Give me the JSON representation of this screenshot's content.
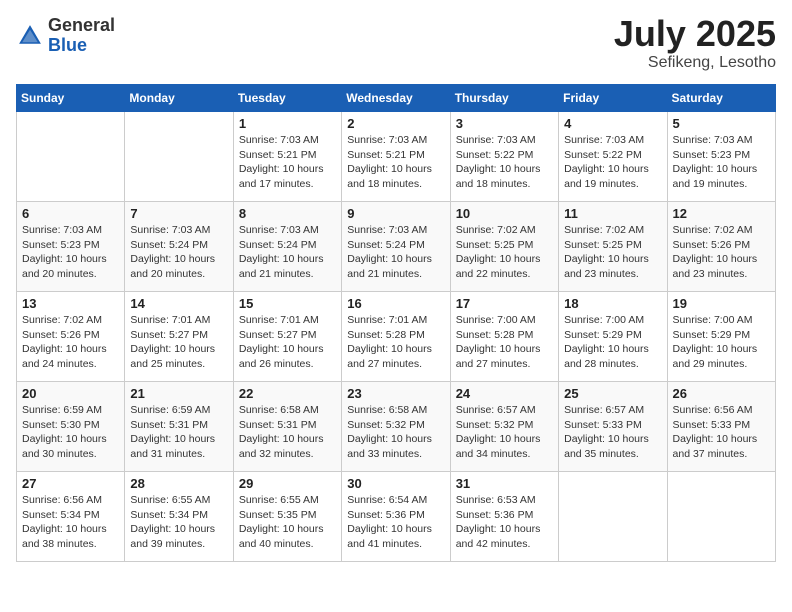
{
  "header": {
    "logo_general": "General",
    "logo_blue": "Blue",
    "month_year": "July 2025",
    "location": "Sefikeng, Lesotho"
  },
  "days_of_week": [
    "Sunday",
    "Monday",
    "Tuesday",
    "Wednesday",
    "Thursday",
    "Friday",
    "Saturday"
  ],
  "weeks": [
    [
      {
        "day": "",
        "info": ""
      },
      {
        "day": "",
        "info": ""
      },
      {
        "day": "1",
        "info": "Sunrise: 7:03 AM\nSunset: 5:21 PM\nDaylight: 10 hours and 17 minutes."
      },
      {
        "day": "2",
        "info": "Sunrise: 7:03 AM\nSunset: 5:21 PM\nDaylight: 10 hours and 18 minutes."
      },
      {
        "day": "3",
        "info": "Sunrise: 7:03 AM\nSunset: 5:22 PM\nDaylight: 10 hours and 18 minutes."
      },
      {
        "day": "4",
        "info": "Sunrise: 7:03 AM\nSunset: 5:22 PM\nDaylight: 10 hours and 19 minutes."
      },
      {
        "day": "5",
        "info": "Sunrise: 7:03 AM\nSunset: 5:23 PM\nDaylight: 10 hours and 19 minutes."
      }
    ],
    [
      {
        "day": "6",
        "info": "Sunrise: 7:03 AM\nSunset: 5:23 PM\nDaylight: 10 hours and 20 minutes."
      },
      {
        "day": "7",
        "info": "Sunrise: 7:03 AM\nSunset: 5:24 PM\nDaylight: 10 hours and 20 minutes."
      },
      {
        "day": "8",
        "info": "Sunrise: 7:03 AM\nSunset: 5:24 PM\nDaylight: 10 hours and 21 minutes."
      },
      {
        "day": "9",
        "info": "Sunrise: 7:03 AM\nSunset: 5:24 PM\nDaylight: 10 hours and 21 minutes."
      },
      {
        "day": "10",
        "info": "Sunrise: 7:02 AM\nSunset: 5:25 PM\nDaylight: 10 hours and 22 minutes."
      },
      {
        "day": "11",
        "info": "Sunrise: 7:02 AM\nSunset: 5:25 PM\nDaylight: 10 hours and 23 minutes."
      },
      {
        "day": "12",
        "info": "Sunrise: 7:02 AM\nSunset: 5:26 PM\nDaylight: 10 hours and 23 minutes."
      }
    ],
    [
      {
        "day": "13",
        "info": "Sunrise: 7:02 AM\nSunset: 5:26 PM\nDaylight: 10 hours and 24 minutes."
      },
      {
        "day": "14",
        "info": "Sunrise: 7:01 AM\nSunset: 5:27 PM\nDaylight: 10 hours and 25 minutes."
      },
      {
        "day": "15",
        "info": "Sunrise: 7:01 AM\nSunset: 5:27 PM\nDaylight: 10 hours and 26 minutes."
      },
      {
        "day": "16",
        "info": "Sunrise: 7:01 AM\nSunset: 5:28 PM\nDaylight: 10 hours and 27 minutes."
      },
      {
        "day": "17",
        "info": "Sunrise: 7:00 AM\nSunset: 5:28 PM\nDaylight: 10 hours and 27 minutes."
      },
      {
        "day": "18",
        "info": "Sunrise: 7:00 AM\nSunset: 5:29 PM\nDaylight: 10 hours and 28 minutes."
      },
      {
        "day": "19",
        "info": "Sunrise: 7:00 AM\nSunset: 5:29 PM\nDaylight: 10 hours and 29 minutes."
      }
    ],
    [
      {
        "day": "20",
        "info": "Sunrise: 6:59 AM\nSunset: 5:30 PM\nDaylight: 10 hours and 30 minutes."
      },
      {
        "day": "21",
        "info": "Sunrise: 6:59 AM\nSunset: 5:31 PM\nDaylight: 10 hours and 31 minutes."
      },
      {
        "day": "22",
        "info": "Sunrise: 6:58 AM\nSunset: 5:31 PM\nDaylight: 10 hours and 32 minutes."
      },
      {
        "day": "23",
        "info": "Sunrise: 6:58 AM\nSunset: 5:32 PM\nDaylight: 10 hours and 33 minutes."
      },
      {
        "day": "24",
        "info": "Sunrise: 6:57 AM\nSunset: 5:32 PM\nDaylight: 10 hours and 34 minutes."
      },
      {
        "day": "25",
        "info": "Sunrise: 6:57 AM\nSunset: 5:33 PM\nDaylight: 10 hours and 35 minutes."
      },
      {
        "day": "26",
        "info": "Sunrise: 6:56 AM\nSunset: 5:33 PM\nDaylight: 10 hours and 37 minutes."
      }
    ],
    [
      {
        "day": "27",
        "info": "Sunrise: 6:56 AM\nSunset: 5:34 PM\nDaylight: 10 hours and 38 minutes."
      },
      {
        "day": "28",
        "info": "Sunrise: 6:55 AM\nSunset: 5:34 PM\nDaylight: 10 hours and 39 minutes."
      },
      {
        "day": "29",
        "info": "Sunrise: 6:55 AM\nSunset: 5:35 PM\nDaylight: 10 hours and 40 minutes."
      },
      {
        "day": "30",
        "info": "Sunrise: 6:54 AM\nSunset: 5:36 PM\nDaylight: 10 hours and 41 minutes."
      },
      {
        "day": "31",
        "info": "Sunrise: 6:53 AM\nSunset: 5:36 PM\nDaylight: 10 hours and 42 minutes."
      },
      {
        "day": "",
        "info": ""
      },
      {
        "day": "",
        "info": ""
      }
    ]
  ]
}
